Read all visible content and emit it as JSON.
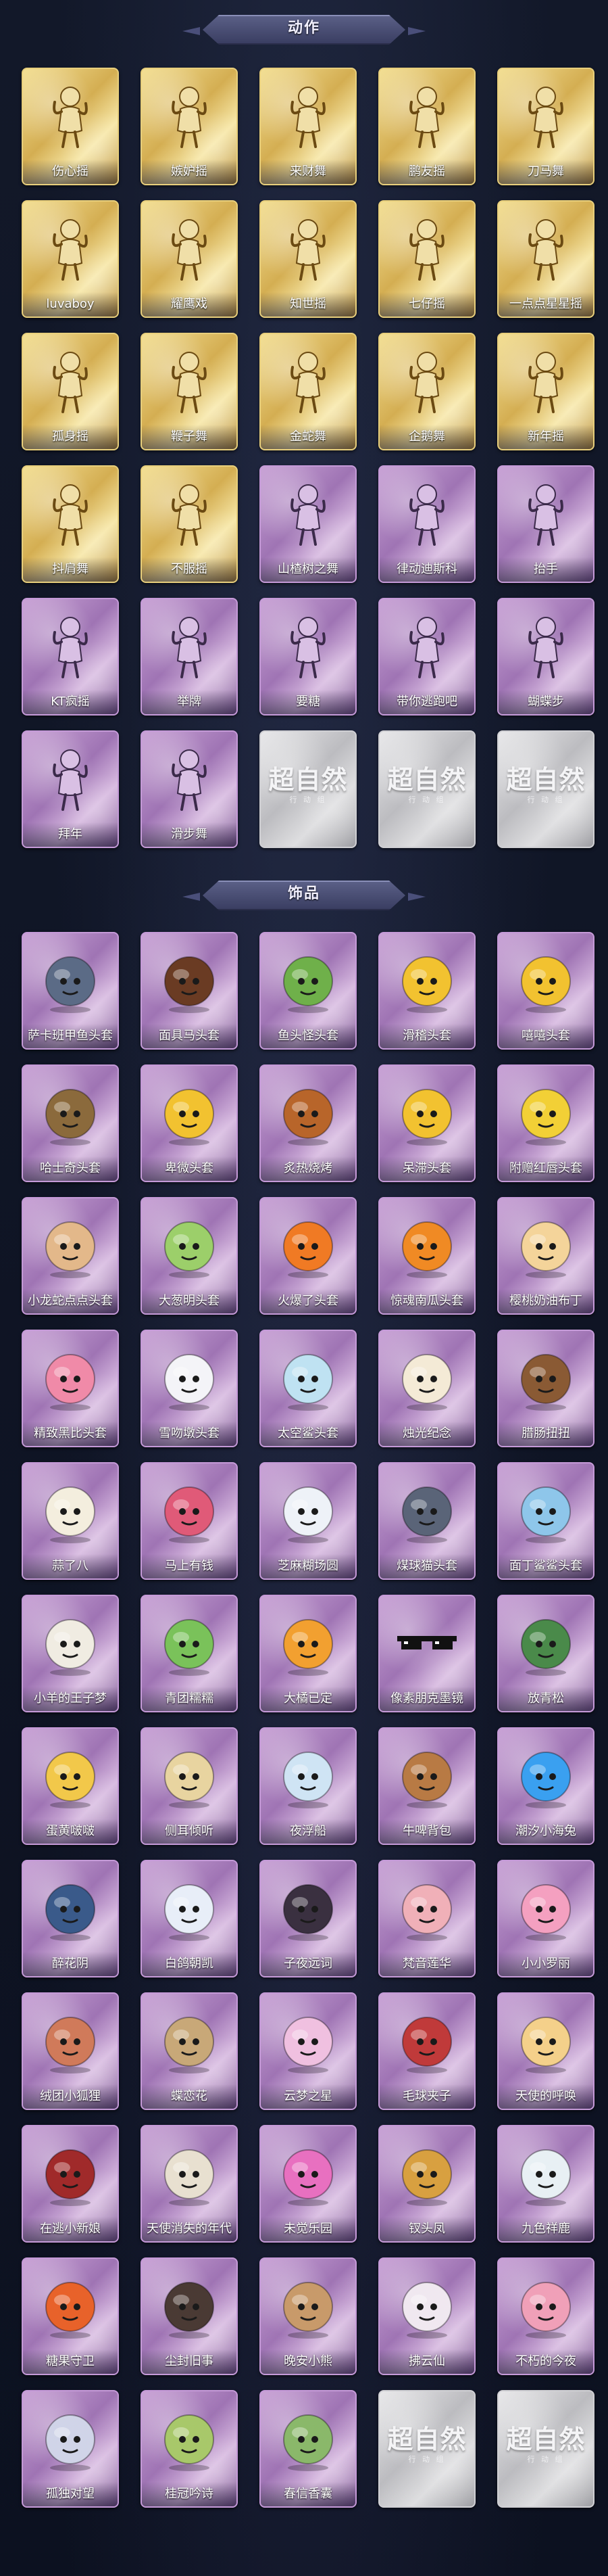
{
  "sections": [
    {
      "title": "动作",
      "items": [
        {
          "label": "伤心摇",
          "tier": "gold",
          "icon": "pose-figure-icon"
        },
        {
          "label": "嫉妒摇",
          "tier": "gold",
          "icon": "pose-figure-icon"
        },
        {
          "label": "来财舞",
          "tier": "gold",
          "icon": "pose-figure-icon"
        },
        {
          "label": "鹏友摇",
          "tier": "gold",
          "icon": "pose-figure-icon"
        },
        {
          "label": "刀马舞",
          "tier": "gold",
          "icon": "pose-figure-icon"
        },
        {
          "label": "luvaboy",
          "tier": "gold",
          "icon": "pose-figure-icon"
        },
        {
          "label": "耀鹰戏",
          "tier": "gold",
          "icon": "pose-figure-icon"
        },
        {
          "label": "知世摇",
          "tier": "gold",
          "icon": "pose-figure-icon"
        },
        {
          "label": "七仔摇",
          "tier": "gold",
          "icon": "pose-figure-icon"
        },
        {
          "label": "一点点星星摇",
          "tier": "gold",
          "icon": "pose-figure-icon"
        },
        {
          "label": "孤身摇",
          "tier": "gold",
          "icon": "pose-figure-icon"
        },
        {
          "label": "鞭子舞",
          "tier": "gold",
          "icon": "pose-figure-icon"
        },
        {
          "label": "金蛇舞",
          "tier": "gold",
          "icon": "pose-figure-icon"
        },
        {
          "label": "企鹅舞",
          "tier": "gold",
          "icon": "pose-figure-icon"
        },
        {
          "label": "新年摇",
          "tier": "gold",
          "icon": "pose-figure-icon"
        },
        {
          "label": "抖肩舞",
          "tier": "gold",
          "icon": "pose-figure-icon"
        },
        {
          "label": "不服摇",
          "tier": "gold",
          "icon": "pose-figure-icon"
        },
        {
          "label": "山楂树之舞",
          "tier": "purple",
          "icon": "pose-figure-icon"
        },
        {
          "label": "律动迪斯科",
          "tier": "purple",
          "icon": "pose-figure-icon"
        },
        {
          "label": "抬手",
          "tier": "purple",
          "icon": "pose-figure-icon"
        },
        {
          "label": "KT疯摇",
          "tier": "purple",
          "icon": "pose-figure-icon"
        },
        {
          "label": "举牌",
          "tier": "purple",
          "icon": "pose-figure-icon"
        },
        {
          "label": "要糖",
          "tier": "purple",
          "icon": "pose-figure-icon"
        },
        {
          "label": "带你逃跑吧",
          "tier": "purple",
          "icon": "pose-figure-icon"
        },
        {
          "label": "蝴蝶步",
          "tier": "purple",
          "icon": "pose-figure-icon"
        },
        {
          "label": "拜年",
          "tier": "purple",
          "icon": "pose-figure-icon"
        },
        {
          "label": "滑步舞",
          "tier": "purple",
          "icon": "pose-figure-icon"
        },
        {
          "label": "",
          "tier": "silver",
          "icon": "placeholder-logo-icon"
        },
        {
          "label": "",
          "tier": "silver",
          "icon": "placeholder-logo-icon"
        },
        {
          "label": "",
          "tier": "silver",
          "icon": "placeholder-logo-icon"
        }
      ]
    },
    {
      "title": "饰品",
      "items": [
        {
          "label": "萨卡班甲鱼头套",
          "tier": "purple",
          "icon": "fish-head-icon"
        },
        {
          "label": "面具马头套",
          "tier": "purple",
          "icon": "horse-head-icon"
        },
        {
          "label": "鱼头怪头套",
          "tier": "purple",
          "icon": "fish-monster-head-icon"
        },
        {
          "label": "滑稽头套",
          "tier": "purple",
          "icon": "smirk-face-icon"
        },
        {
          "label": "嘻嘻头套",
          "tier": "purple",
          "icon": "grin-face-icon"
        },
        {
          "label": "哈士奇头套",
          "tier": "purple",
          "icon": "husky-head-icon"
        },
        {
          "label": "卑微头套",
          "tier": "purple",
          "icon": "humble-face-icon"
        },
        {
          "label": "炙热烧烤",
          "tier": "purple",
          "icon": "grill-head-icon"
        },
        {
          "label": "呆滞头套",
          "tier": "purple",
          "icon": "dazed-face-icon"
        },
        {
          "label": "附赠红唇头套",
          "tier": "purple",
          "icon": "pikachu-head-icon"
        },
        {
          "label": "小龙蛇点点头套",
          "tier": "purple",
          "icon": "worm-head-icon"
        },
        {
          "label": "大葱明头套",
          "tier": "purple",
          "icon": "scallion-head-icon"
        },
        {
          "label": "火爆了头套",
          "tier": "purple",
          "icon": "fire-head-icon"
        },
        {
          "label": "惊魂南瓜头套",
          "tier": "purple",
          "icon": "pumpkin-head-icon"
        },
        {
          "label": "樱桃奶油布丁",
          "tier": "purple",
          "icon": "pudding-head-icon"
        },
        {
          "label": "精致黑比头套",
          "tier": "purple",
          "icon": "pig-head-icon"
        },
        {
          "label": "雪吻墩头套",
          "tier": "purple",
          "icon": "snowman-head-icon"
        },
        {
          "label": "太空鲨头套",
          "tier": "purple",
          "icon": "shark-head-icon"
        },
        {
          "label": "烛光纪念",
          "tier": "purple",
          "icon": "candle-head-icon"
        },
        {
          "label": "腊肠扭扭",
          "tier": "purple",
          "icon": "dachshund-head-icon"
        },
        {
          "label": "蒜了八",
          "tier": "purple",
          "icon": "garlic-head-icon"
        },
        {
          "label": "马上有钱",
          "tier": "purple",
          "icon": "pony-head-icon"
        },
        {
          "label": "芝麻糊场圆",
          "tier": "purple",
          "icon": "mochi-head-icon"
        },
        {
          "label": "煤球猫头套",
          "tier": "purple",
          "icon": "cat-head-icon"
        },
        {
          "label": "面丁鲨鲨头套",
          "tier": "purple",
          "icon": "dolphin-head-icon"
        },
        {
          "label": "小羊的王子梦",
          "tier": "purple",
          "icon": "sheep-head-icon"
        },
        {
          "label": "青团糯糯",
          "tier": "purple",
          "icon": "qingtuan-head-icon"
        },
        {
          "label": "大橘已定",
          "tier": "purple",
          "icon": "orange-icon"
        },
        {
          "label": "像素朋克墨镜",
          "tier": "purple",
          "icon": "pixel-sunglasses-icon"
        },
        {
          "label": "放青松",
          "tier": "purple",
          "icon": "pine-icon"
        },
        {
          "label": "蛋黄啵啵",
          "tier": "purple",
          "icon": "yolk-chick-icon"
        },
        {
          "label": "侧耳倾听",
          "tier": "purple",
          "icon": "ear-ornament-icon"
        },
        {
          "label": "夜浮船",
          "tier": "purple",
          "icon": "night-boat-icon"
        },
        {
          "label": "牛啤背包",
          "tier": "purple",
          "icon": "beer-backpack-icon"
        },
        {
          "label": "潮汐小海兔",
          "tier": "purple",
          "icon": "blue-cat-icon"
        },
        {
          "label": "醉花阴",
          "tier": "purple",
          "icon": "lantern-ornament-icon"
        },
        {
          "label": "白鸽朝凯",
          "tier": "purple",
          "icon": "white-dove-icon"
        },
        {
          "label": "子夜远词",
          "tier": "purple",
          "icon": "raven-doll-icon"
        },
        {
          "label": "梵音莲华",
          "tier": "purple",
          "icon": "lotus-doll-icon"
        },
        {
          "label": "小小罗丽",
          "tier": "purple",
          "icon": "princess-doll-icon"
        },
        {
          "label": "绒团小狐狸",
          "tier": "purple",
          "icon": "fox-charm-icon"
        },
        {
          "label": "蝶恋花",
          "tier": "purple",
          "icon": "butterfly-charm-icon"
        },
        {
          "label": "云梦之星",
          "tier": "purple",
          "icon": "cloud-star-icon"
        },
        {
          "label": "毛球夹子",
          "tier": "purple",
          "icon": "nutcracker-icon"
        },
        {
          "label": "天使的呼唤",
          "tier": "purple",
          "icon": "angel-doll-icon"
        },
        {
          "label": "在逃小新娘",
          "tier": "purple",
          "icon": "bride-doll-icon"
        },
        {
          "label": "天使消失的年代",
          "tier": "purple",
          "icon": "dark-angel-icon"
        },
        {
          "label": "未觉乐园",
          "tier": "purple",
          "icon": "pink-girl-icon"
        },
        {
          "label": "钗头凤",
          "tier": "purple",
          "icon": "phoenix-doll-icon"
        },
        {
          "label": "九色祥鹿",
          "tier": "purple",
          "icon": "deer-charm-icon"
        },
        {
          "label": "糖果守卫",
          "tier": "purple",
          "icon": "candy-guard-icon"
        },
        {
          "label": "尘封旧事",
          "tier": "purple",
          "icon": "boy-doll-icon"
        },
        {
          "label": "晚安小熊",
          "tier": "purple",
          "icon": "bear-charm-icon"
        },
        {
          "label": "拂云仙",
          "tier": "purple",
          "icon": "fairy-charm-icon"
        },
        {
          "label": "不朽的今夜",
          "tier": "purple",
          "icon": "pink-charm-icon"
        },
        {
          "label": "孤独对望",
          "tier": "purple",
          "icon": "lonely-doll-icon"
        },
        {
          "label": "桂冠吟诗",
          "tier": "purple",
          "icon": "laurel-charm-icon"
        },
        {
          "label": "春信香囊",
          "tier": "purple",
          "icon": "sachet-icon"
        },
        {
          "label": "",
          "tier": "silver",
          "icon": "placeholder-logo-icon"
        },
        {
          "label": "",
          "tier": "silver",
          "icon": "placeholder-logo-icon"
        }
      ]
    }
  ],
  "placeholder": {
    "logo_text": "超自然",
    "logo_sub": "行 动 组"
  },
  "colors": {
    "gold": "#d4ae52",
    "purple": "#9f74b4",
    "silver": "#bcbcc0",
    "background": "#0f1424"
  }
}
